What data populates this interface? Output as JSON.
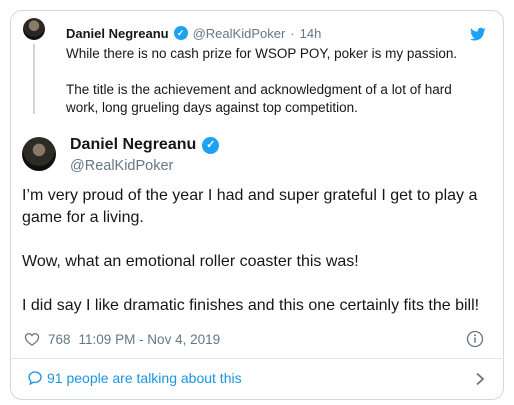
{
  "parent_tweet": {
    "name": "Daniel Negreanu",
    "handle": "@RealKidPoker",
    "separator": "·",
    "time": "14h",
    "paragraphs": [
      "While there is no cash prize for WSOP POY, poker is my passion.",
      "The title is the achievement and acknowledgment of a lot of hard work, long grueling days against top competition."
    ]
  },
  "tweet": {
    "name": "Daniel Negreanu",
    "handle": "@RealKidPoker",
    "paragraphs": [
      "I’m very proud of the year I had and super grateful I get to play a game for a living.",
      "Wow, what an emotional roller coaster this was!",
      "I did say I like dramatic finishes and this one certainly fits the bill!"
    ],
    "likes": "768",
    "timestamp": "11:09 PM - Nov 4, 2019"
  },
  "footer": {
    "talking_label": "91 people are talking about this"
  },
  "icons": {
    "verified": "verified-badge-icon",
    "logo": "twitter-bird-icon",
    "like": "heart-icon",
    "info": "info-icon",
    "reply": "speech-bubble-icon",
    "chevron": "chevron-right-icon"
  },
  "colors": {
    "accent": "#1da1f2",
    "link": "#1b95e0",
    "muted": "#657786",
    "border": "#cfd9de"
  }
}
